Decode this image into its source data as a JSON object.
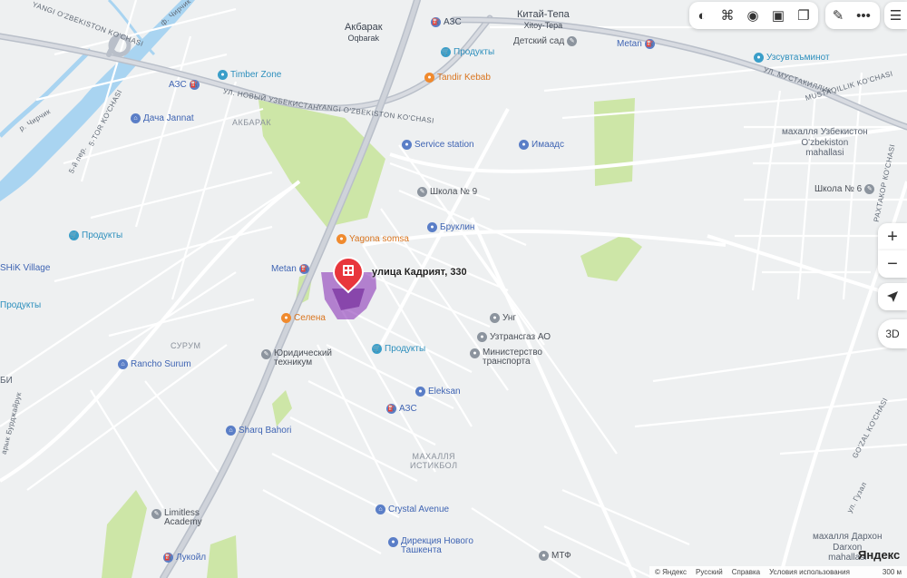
{
  "marker": {
    "label": "улица Кадрият, 330",
    "icon": "building-icon"
  },
  "places": {
    "akbarak": [
      "Акбарак",
      "Oqbarak"
    ],
    "kitai_tepa": [
      "Китай-Тепа",
      "Xitoy-Tepa"
    ],
    "akbarak_street": "АКБАРАК",
    "surum": "СУРУМ",
    "makhallya_uzb": [
      "махалля Узбекистон",
      "O'zbekiston",
      "mahallasi"
    ],
    "makhallya_istikbol": [
      "МАХАЛЛЯ",
      "ИСТИКБОЛ"
    ],
    "makhallya_darkhon": [
      "махалля Дархон",
      "Darxon",
      "mahallasi"
    ]
  },
  "streets": {
    "s1": "YANGI O'ZBEKISTON KO'CHASI",
    "s2": "УЛ. НОВЫЙ УЗБЕКИСТАН",
    "s3": "YANGI O'ZBEKISTON KO'CHASI",
    "s4": "УЛ. МУСТАКИЛЛИК",
    "s5": "MUSTAQILLIK KO'CHASI",
    "s6": "ф. Чирчик",
    "s7": "р. Чирчик",
    "s8": "5-TOR KO'CHASI",
    "s9": "5-й пер.",
    "s10": "РАХТАКОР КО'CHASI",
    "s11": "ул. Гузал",
    "s12": "GO'ZAL KO'CHASI",
    "s13": "арык Бурджайрук"
  },
  "pois": [
    {
      "name": "АЗС",
      "color": "blue",
      "icon": "fuel-icon"
    },
    {
      "name": "Продукты",
      "color": "teal",
      "icon": "cart-icon"
    },
    {
      "name": "Детский сад",
      "color": "gray",
      "icon": "school-icon"
    },
    {
      "name": "Metan",
      "color": "blue",
      "icon": "fuel-icon"
    },
    {
      "name": "Узсувтаъминот",
      "color": "teal",
      "icon": "office-icon"
    },
    {
      "name": "Timber Zone",
      "color": "teal",
      "icon": "shop-icon"
    },
    {
      "name": "АЗС",
      "color": "blue",
      "icon": "fuel-icon"
    },
    {
      "name": "Tandir Kebab",
      "color": "orange",
      "icon": "food-icon"
    },
    {
      "name": "Дача Jannat",
      "color": "blue",
      "icon": "house-icon"
    },
    {
      "name": "Service station",
      "color": "blue",
      "icon": "car-icon"
    },
    {
      "name": "Имаадс",
      "color": "blue",
      "icon": "office-icon"
    },
    {
      "name": "Школа № 9",
      "color": "gray",
      "icon": "school-icon"
    },
    {
      "name": "Школа № 6",
      "color": "gray",
      "icon": "school-icon"
    },
    {
      "name": "Бруклин",
      "color": "blue",
      "icon": "shop-icon"
    },
    {
      "name": "Продукты",
      "color": "teal",
      "icon": "cart-icon"
    },
    {
      "name": "Yagona somsa",
      "color": "orange",
      "icon": "food-icon"
    },
    {
      "name": "Metan",
      "color": "blue",
      "icon": "fuel-icon"
    },
    {
      "name": "Селена",
      "color": "orange",
      "icon": "food-icon"
    },
    {
      "name": "Унг",
      "color": "gray",
      "icon": "office-icon"
    },
    {
      "name": "Узтрансгаз АО",
      "color": "gray",
      "icon": "office-icon"
    },
    {
      "name": "Министерство",
      "color": "gray",
      "icon": "office-icon",
      "line2": "транспорта"
    },
    {
      "name": "Юридический",
      "color": "gray",
      "icon": "school-icon",
      "line2": "техникум"
    },
    {
      "name": "Продукты",
      "color": "teal",
      "icon": "cart-icon"
    },
    {
      "name": "Rancho Surum",
      "color": "blue",
      "icon": "house-icon"
    },
    {
      "name": "Eleksan",
      "color": "blue",
      "icon": "shop-icon"
    },
    {
      "name": "АЗС",
      "color": "blue",
      "icon": "fuel-icon"
    },
    {
      "name": "Sharq Bahori",
      "color": "blue",
      "icon": "house-icon"
    },
    {
      "name": "Limitless",
      "color": "gray",
      "icon": "school-icon",
      "line2": "Academy"
    },
    {
      "name": "Crystal Avenue",
      "color": "blue",
      "icon": "house-icon"
    },
    {
      "name": "Дирекция Нового",
      "color": "blue",
      "icon": "office-icon",
      "line2": "Ташкента"
    },
    {
      "name": "МТФ",
      "color": "gray",
      "icon": "office-icon"
    },
    {
      "name": "Лукойл",
      "color": "blue",
      "icon": "fuel-icon"
    },
    {
      "name": "Продукты",
      "color": "teal",
      "icon": "cart-icon"
    },
    {
      "name": "SHiK Village",
      "color": "blue",
      "icon": "house-icon"
    },
    {
      "name": "Продукты",
      "color": "teal",
      "icon": "cart-icon"
    }
  ],
  "edge_labels": {
    "bi": "БИ"
  },
  "toolbar": {
    "layers": [
      "layers-icon",
      "panorama-icon",
      "photo-icon",
      "transit-icon",
      "map-type-icon"
    ],
    "tools": [
      "ruler-icon",
      "more-icon"
    ],
    "menu": "menu-icon"
  },
  "controls": {
    "zoom_in": "+",
    "zoom_out": "−",
    "locate": "locate-icon",
    "three_d": "3D"
  },
  "brand": "Яндекс",
  "footer": {
    "copyright": "© Яндекс",
    "language": "Русский",
    "help": "Справка",
    "terms": "Условия использования",
    "scale": "300 м"
  },
  "colors": {
    "background": "#eef0f1",
    "road_major": "#b9bfc9",
    "road_minor": "#ffffff",
    "park": "#cde6a7",
    "river": "#a9d4f1",
    "marker": "#e8363c",
    "area_highlight": "#8b36b8"
  }
}
